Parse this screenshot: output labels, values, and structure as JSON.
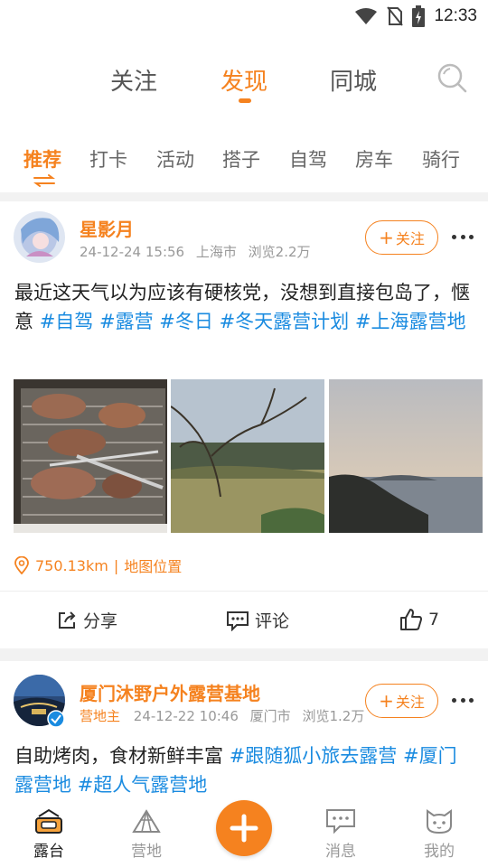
{
  "status_bar": {
    "time": "12:33",
    "icons": [
      "wifi-icon",
      "no-sim-icon",
      "battery-charging-icon"
    ]
  },
  "top_tabs": [
    "关注",
    "发现",
    "同城"
  ],
  "top_active": "发现",
  "sub_tabs": [
    "推荐",
    "打卡",
    "活动",
    "搭子",
    "自驾",
    "房车",
    "骑行"
  ],
  "sub_active": "推荐",
  "posts": [
    {
      "author": "星影月",
      "role": "",
      "time": "24-12-24 15:56",
      "city": "上海市",
      "views": "浏览2.2万",
      "follow_label": "关注",
      "text": "最近这天气以为应该有硬核党，没想到直接包岛了，惬意",
      "tags": [
        "#自驾",
        "#露营",
        "#冬日",
        "#冬天露营计划",
        "#上海露营地"
      ],
      "photos": [
        "bbq-lamb-chops-photo",
        "grassland-tree-photo",
        "sea-sunset-photo"
      ],
      "distance": "750.13km",
      "map_link": "地图位置",
      "share_label": "分享",
      "comment_label": "评论",
      "likes": "7"
    },
    {
      "author": "厦门沐野户外露营基地",
      "role": "营地主",
      "time": "24-12-22 10:46",
      "city": "厦门市",
      "views": "浏览1.2万",
      "follow_label": "关注",
      "text": "自助烤肉，食材新鲜丰富",
      "tags": [
        "#跟随狐小旅去露营",
        "#厦门露营地",
        "#超人气露营地"
      ]
    }
  ],
  "bottom_nav": [
    {
      "label": "露台",
      "icon": "terrace-icon",
      "active": true
    },
    {
      "label": "营地",
      "icon": "tent-icon",
      "active": false
    },
    {
      "label": "",
      "icon": "plus-icon",
      "active": false
    },
    {
      "label": "消息",
      "icon": "message-icon",
      "active": false
    },
    {
      "label": "我的",
      "icon": "cat-profile-icon",
      "active": false
    }
  ],
  "colors": {
    "accent": "#f5821f",
    "tag": "#1a8be0",
    "muted": "#999999"
  }
}
